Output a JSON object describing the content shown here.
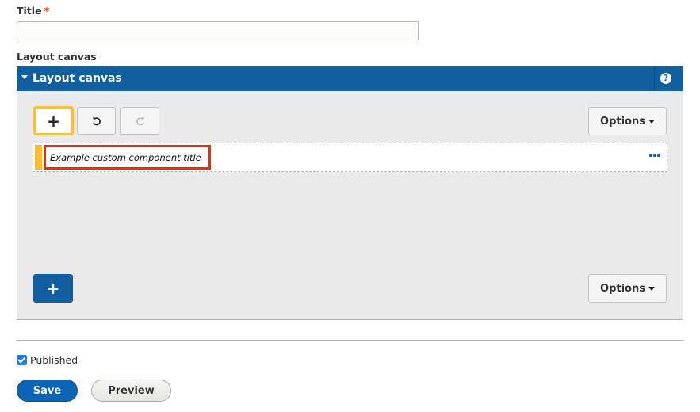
{
  "title_field": {
    "label": "Title",
    "required_marker": "*",
    "value": "",
    "placeholder": ""
  },
  "layout_canvas": {
    "field_label": "Layout canvas",
    "panel_title": "Layout canvas",
    "help_icon": "?",
    "toolbar": {
      "add_icon": "+",
      "undo_icon": "undo-icon",
      "redo_icon": "redo-icon",
      "options_label": "Options"
    },
    "components": [
      {
        "title": "Example custom component title"
      }
    ],
    "bottom_toolbar": {
      "add_icon": "+",
      "options_label": "Options"
    }
  },
  "published": {
    "label": "Published",
    "checked": true
  },
  "actions": {
    "save_label": "Save",
    "preview_label": "Preview"
  },
  "colors": {
    "header_blue": "#115f9e",
    "focus_yellow": "#f9be3b",
    "highlight_red": "#f52a00",
    "save_blue": "#0c64b5"
  }
}
